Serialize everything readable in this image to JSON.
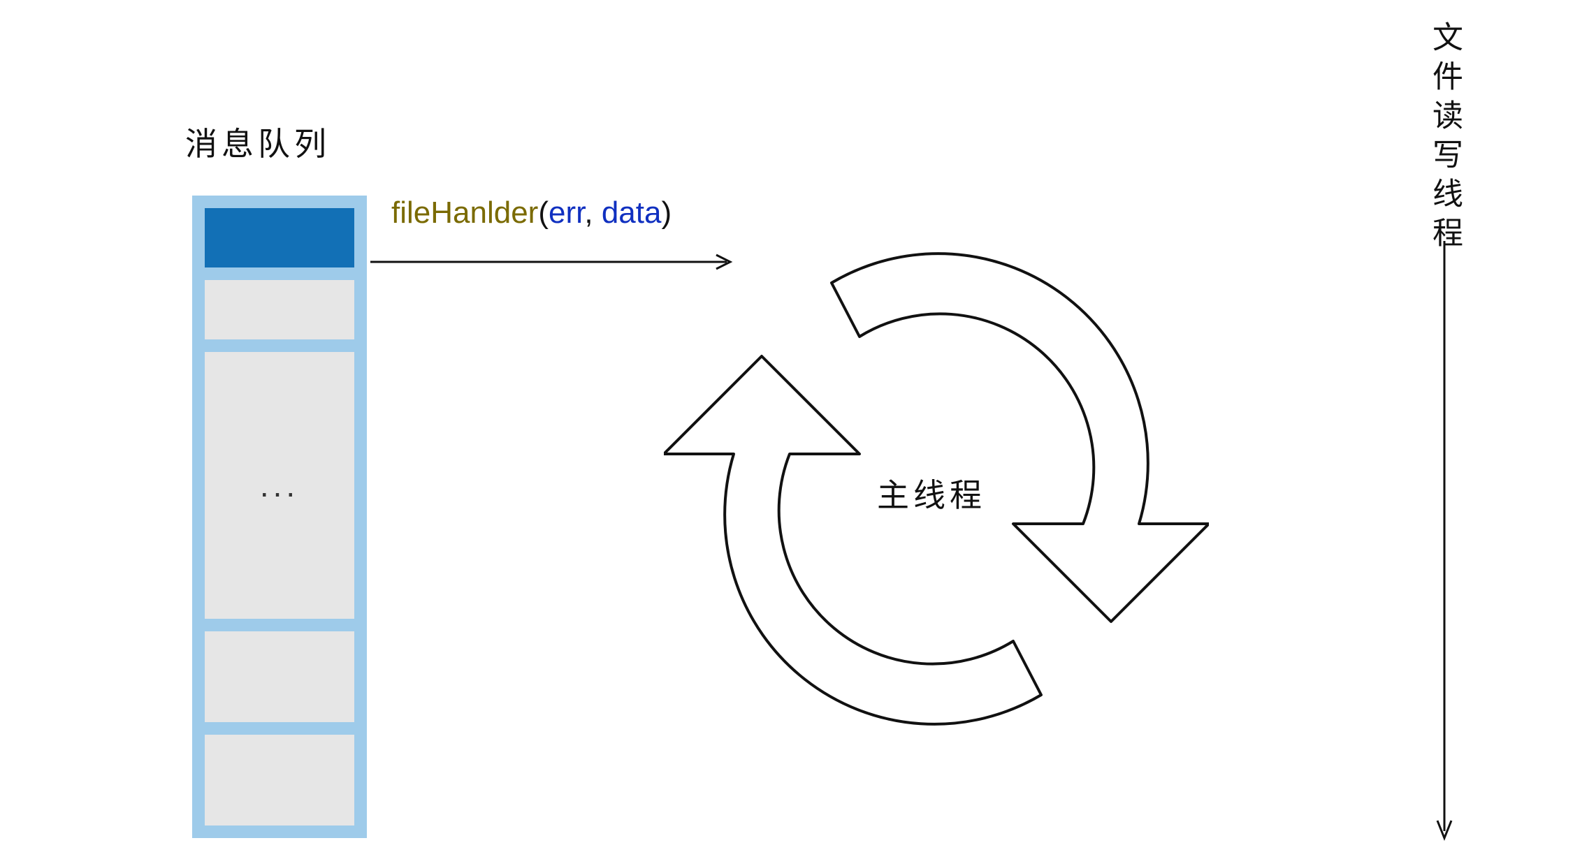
{
  "queue": {
    "title": "消息队列",
    "ellipsis": "..."
  },
  "callback": {
    "fn": "fileHanlder",
    "open": "(",
    "arg1": "err",
    "comma": ", ",
    "arg2": "data",
    "close": ")"
  },
  "main_thread_label": "主线程",
  "io_thread_label": "文件读写线程",
  "colors": {
    "queue_bg": "#9ecbea",
    "active_slot": "#1270b6",
    "slot": "#e6e6e6",
    "fn_name": "#7a6a00",
    "arg": "#1030c0"
  }
}
